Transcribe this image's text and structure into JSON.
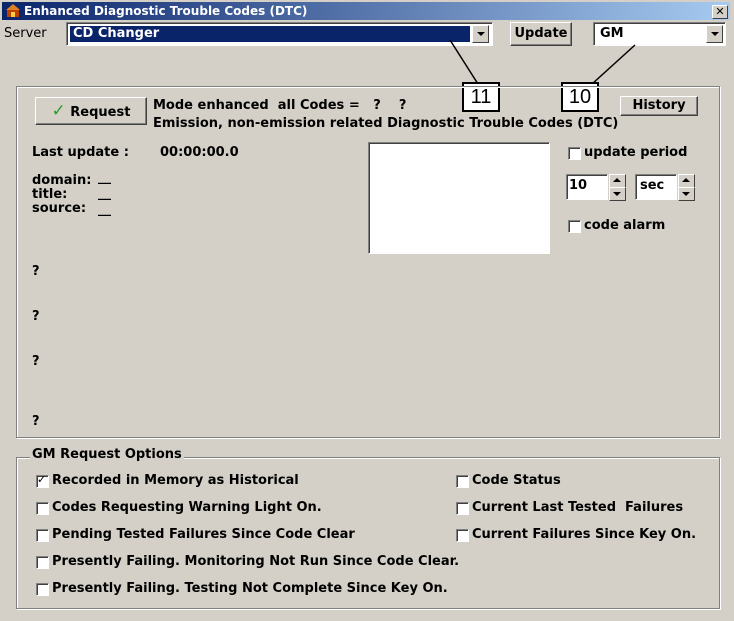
{
  "window": {
    "title": "Enhanced Diagnostic Trouble Codes (DTC)",
    "close_glyph": "✕"
  },
  "server": {
    "label": "Server",
    "value": "CD Changer",
    "update_label": "Update",
    "manufacturer": "GM"
  },
  "callouts": {
    "left": "11",
    "right": "10"
  },
  "request": {
    "button_label": "Request",
    "mode_line": "Mode enhanced  all Codes =   ?    ?",
    "description": "Emission, non-emission  related Diagnostic Trouble Codes (DTC)",
    "history_label": "History"
  },
  "status": {
    "last_update_label": "Last update :",
    "last_update_value": "00:00:00.0",
    "domain_label": "domain:",
    "domain_value": "__",
    "title_label": "title:",
    "title_value": "__",
    "source_label": "source:",
    "source_value": "__",
    "q1": "?",
    "q2": "?",
    "q3": "?",
    "q4": "?"
  },
  "timer": {
    "update_period_label": "update period",
    "period_value": "10",
    "unit_value": "sec",
    "code_alarm_label": "code alarm"
  },
  "options": {
    "group_label": "GM Request Options",
    "recorded": "Recorded in Memory as Historical",
    "warning": "Codes Requesting Warning Light On.",
    "pending": "Pending Tested Failures Since Code Clear",
    "failing_monitor": "Presently Failing.  Monitoring Not Run Since Code Clear.",
    "failing_testing": "Presently Failing.  Testing  Not Complete Since Key On.",
    "code_status": "Code Status",
    "current_last": "Current Last Tested  Failures",
    "current_key": "Current Failures Since Key On."
  },
  "colors": {
    "face": "#d4d0c8",
    "title_start": "#0a246a",
    "title_end": "#a6caf0",
    "selection": "#0a246a",
    "check_green": "#2a9d2a"
  }
}
